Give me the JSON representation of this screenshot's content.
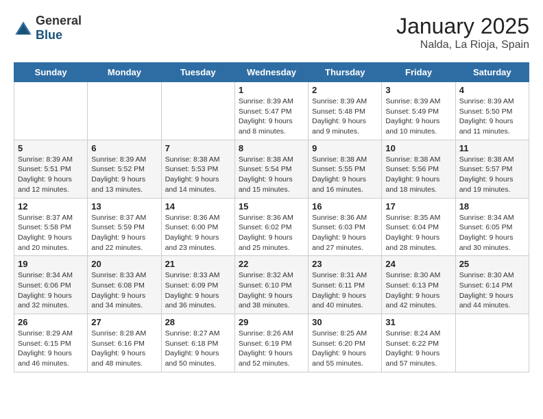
{
  "header": {
    "logo_general": "General",
    "logo_blue": "Blue",
    "month": "January 2025",
    "location": "Nalda, La Rioja, Spain"
  },
  "days_of_week": [
    "Sunday",
    "Monday",
    "Tuesday",
    "Wednesday",
    "Thursday",
    "Friday",
    "Saturday"
  ],
  "weeks": [
    [
      {
        "day": "",
        "info": ""
      },
      {
        "day": "",
        "info": ""
      },
      {
        "day": "",
        "info": ""
      },
      {
        "day": "1",
        "info": "Sunrise: 8:39 AM\nSunset: 5:47 PM\nDaylight: 9 hours\nand 8 minutes."
      },
      {
        "day": "2",
        "info": "Sunrise: 8:39 AM\nSunset: 5:48 PM\nDaylight: 9 hours\nand 9 minutes."
      },
      {
        "day": "3",
        "info": "Sunrise: 8:39 AM\nSunset: 5:49 PM\nDaylight: 9 hours\nand 10 minutes."
      },
      {
        "day": "4",
        "info": "Sunrise: 8:39 AM\nSunset: 5:50 PM\nDaylight: 9 hours\nand 11 minutes."
      }
    ],
    [
      {
        "day": "5",
        "info": "Sunrise: 8:39 AM\nSunset: 5:51 PM\nDaylight: 9 hours\nand 12 minutes."
      },
      {
        "day": "6",
        "info": "Sunrise: 8:39 AM\nSunset: 5:52 PM\nDaylight: 9 hours\nand 13 minutes."
      },
      {
        "day": "7",
        "info": "Sunrise: 8:38 AM\nSunset: 5:53 PM\nDaylight: 9 hours\nand 14 minutes."
      },
      {
        "day": "8",
        "info": "Sunrise: 8:38 AM\nSunset: 5:54 PM\nDaylight: 9 hours\nand 15 minutes."
      },
      {
        "day": "9",
        "info": "Sunrise: 8:38 AM\nSunset: 5:55 PM\nDaylight: 9 hours\nand 16 minutes."
      },
      {
        "day": "10",
        "info": "Sunrise: 8:38 AM\nSunset: 5:56 PM\nDaylight: 9 hours\nand 18 minutes."
      },
      {
        "day": "11",
        "info": "Sunrise: 8:38 AM\nSunset: 5:57 PM\nDaylight: 9 hours\nand 19 minutes."
      }
    ],
    [
      {
        "day": "12",
        "info": "Sunrise: 8:37 AM\nSunset: 5:58 PM\nDaylight: 9 hours\nand 20 minutes."
      },
      {
        "day": "13",
        "info": "Sunrise: 8:37 AM\nSunset: 5:59 PM\nDaylight: 9 hours\nand 22 minutes."
      },
      {
        "day": "14",
        "info": "Sunrise: 8:36 AM\nSunset: 6:00 PM\nDaylight: 9 hours\nand 23 minutes."
      },
      {
        "day": "15",
        "info": "Sunrise: 8:36 AM\nSunset: 6:02 PM\nDaylight: 9 hours\nand 25 minutes."
      },
      {
        "day": "16",
        "info": "Sunrise: 8:36 AM\nSunset: 6:03 PM\nDaylight: 9 hours\nand 27 minutes."
      },
      {
        "day": "17",
        "info": "Sunrise: 8:35 AM\nSunset: 6:04 PM\nDaylight: 9 hours\nand 28 minutes."
      },
      {
        "day": "18",
        "info": "Sunrise: 8:34 AM\nSunset: 6:05 PM\nDaylight: 9 hours\nand 30 minutes."
      }
    ],
    [
      {
        "day": "19",
        "info": "Sunrise: 8:34 AM\nSunset: 6:06 PM\nDaylight: 9 hours\nand 32 minutes."
      },
      {
        "day": "20",
        "info": "Sunrise: 8:33 AM\nSunset: 6:08 PM\nDaylight: 9 hours\nand 34 minutes."
      },
      {
        "day": "21",
        "info": "Sunrise: 8:33 AM\nSunset: 6:09 PM\nDaylight: 9 hours\nand 36 minutes."
      },
      {
        "day": "22",
        "info": "Sunrise: 8:32 AM\nSunset: 6:10 PM\nDaylight: 9 hours\nand 38 minutes."
      },
      {
        "day": "23",
        "info": "Sunrise: 8:31 AM\nSunset: 6:11 PM\nDaylight: 9 hours\nand 40 minutes."
      },
      {
        "day": "24",
        "info": "Sunrise: 8:30 AM\nSunset: 6:13 PM\nDaylight: 9 hours\nand 42 minutes."
      },
      {
        "day": "25",
        "info": "Sunrise: 8:30 AM\nSunset: 6:14 PM\nDaylight: 9 hours\nand 44 minutes."
      }
    ],
    [
      {
        "day": "26",
        "info": "Sunrise: 8:29 AM\nSunset: 6:15 PM\nDaylight: 9 hours\nand 46 minutes."
      },
      {
        "day": "27",
        "info": "Sunrise: 8:28 AM\nSunset: 6:16 PM\nDaylight: 9 hours\nand 48 minutes."
      },
      {
        "day": "28",
        "info": "Sunrise: 8:27 AM\nSunset: 6:18 PM\nDaylight: 9 hours\nand 50 minutes."
      },
      {
        "day": "29",
        "info": "Sunrise: 8:26 AM\nSunset: 6:19 PM\nDaylight: 9 hours\nand 52 minutes."
      },
      {
        "day": "30",
        "info": "Sunrise: 8:25 AM\nSunset: 6:20 PM\nDaylight: 9 hours\nand 55 minutes."
      },
      {
        "day": "31",
        "info": "Sunrise: 8:24 AM\nSunset: 6:22 PM\nDaylight: 9 hours\nand 57 minutes."
      },
      {
        "day": "",
        "info": ""
      }
    ]
  ]
}
